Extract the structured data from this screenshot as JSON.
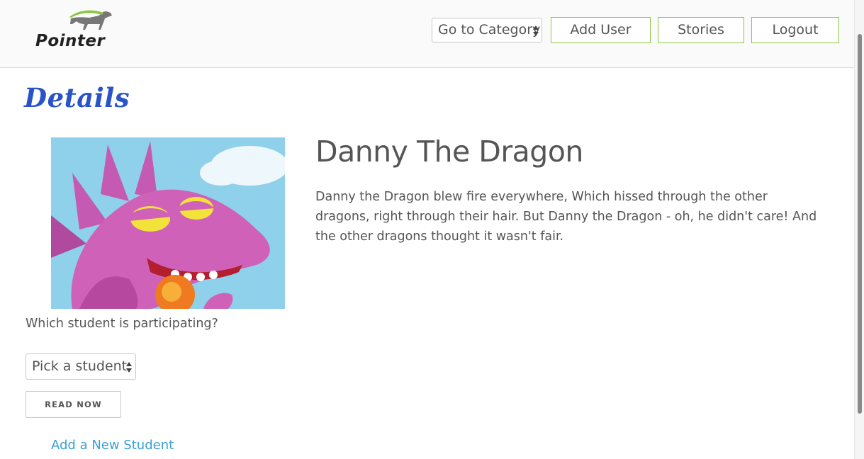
{
  "header": {
    "logo_text": "Pointer",
    "category_select": "Go to Category",
    "nav": {
      "add_user": "Add User",
      "stories": "Stories",
      "logout": "Logout"
    }
  },
  "page": {
    "heading": "Details"
  },
  "story": {
    "title": "Danny The Dragon",
    "description": "Danny the Dragon blew fire everywhere, Which hissed through the other dragons, right through their hair. But Danny the Dragon - oh, he didn't care! And the other dragons thought it wasn't fair.",
    "cover_image": "dragon-illustration"
  },
  "participation": {
    "question": "Which student is participating?",
    "student_select": "Pick a student",
    "read_button": "READ NOW",
    "add_student_link": "Add a New Student"
  },
  "colors": {
    "accent_green": "#8cc63f",
    "heading_blue": "#2a53c9",
    "link_blue": "#3aa0d4"
  }
}
